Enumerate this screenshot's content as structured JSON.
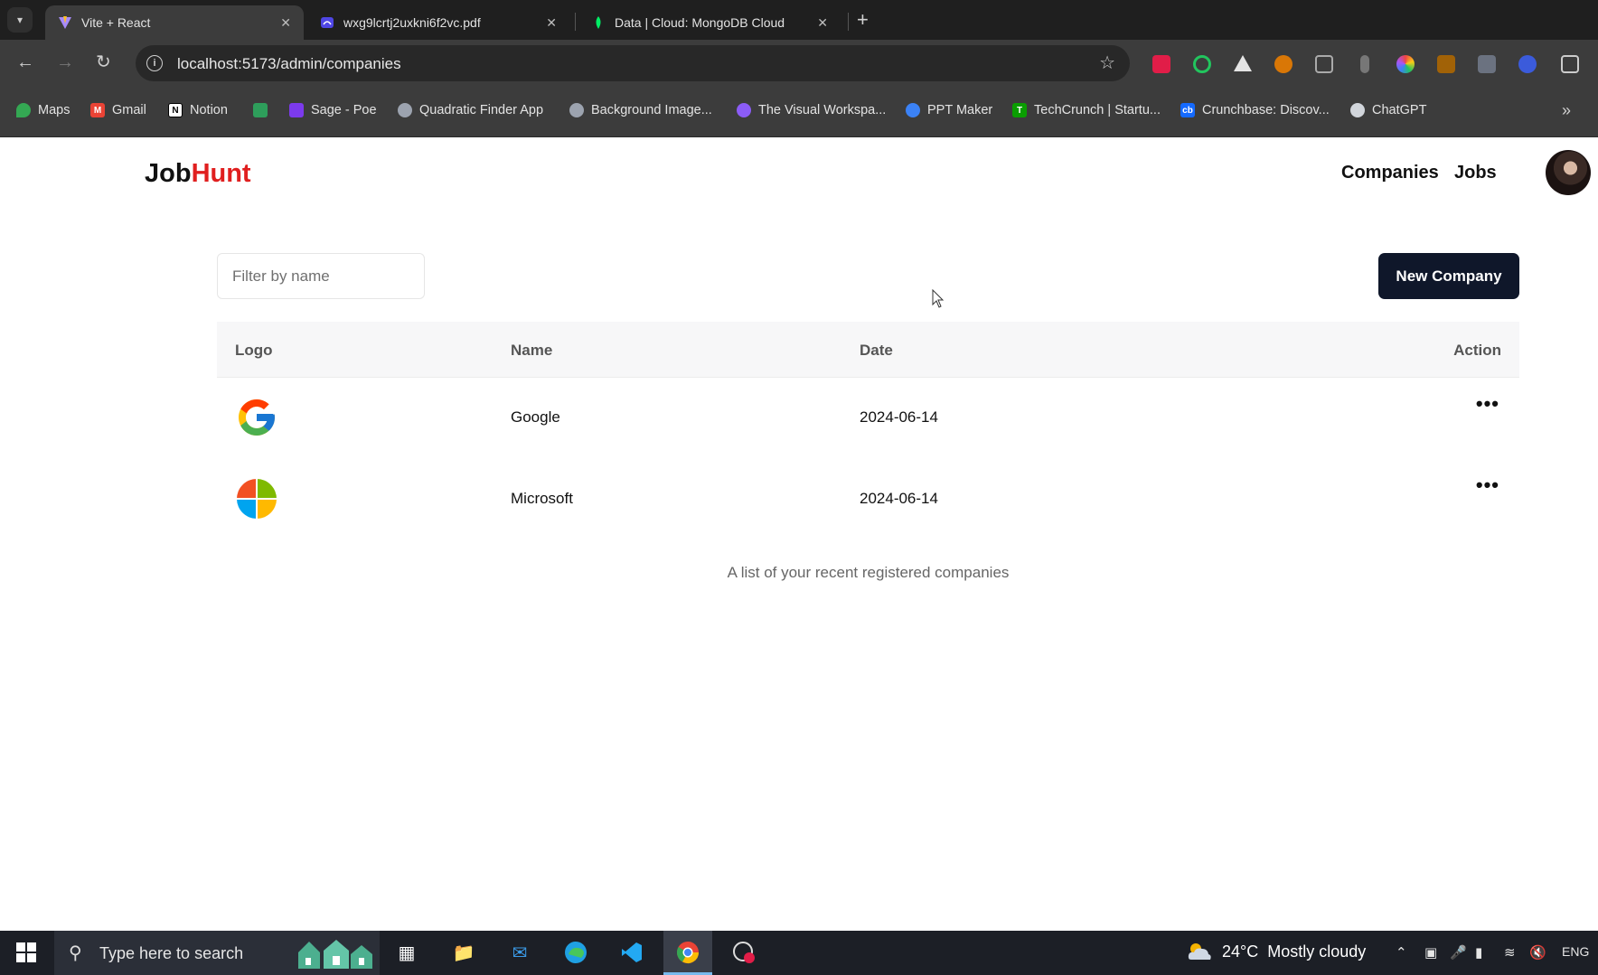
{
  "browser": {
    "tabs": [
      {
        "title": "Vite + React",
        "active": true
      },
      {
        "title": "wxg9lcrtj2uxkni6f2vc.pdf",
        "active": false
      },
      {
        "title": "Data | Cloud: MongoDB Cloud",
        "active": false
      }
    ],
    "url": "localhost:5173/admin/companies",
    "bookmarks": [
      {
        "label": "Maps",
        "color": "#34a853"
      },
      {
        "label": "Gmail",
        "color": "#ea4335"
      },
      {
        "label": "Notion",
        "color": "#ffffff"
      },
      {
        "label": "",
        "color": "#2e9e5b"
      },
      {
        "label": "Sage - Poe",
        "color": "#7c3aed"
      },
      {
        "label": "Quadratic Finder App",
        "color": "#9ca3af"
      },
      {
        "label": "Background Image...",
        "color": "#9ca3af"
      },
      {
        "label": "The Visual Workspa...",
        "color": "#8b5cf6"
      },
      {
        "label": "PPT Maker",
        "color": "#3b82f6"
      },
      {
        "label": "TechCrunch | Startu...",
        "color": "#0a9e01"
      },
      {
        "label": "Crunchbase: Discov...",
        "color": "#146aff"
      },
      {
        "label": "ChatGPT",
        "color": "#d1d5db"
      }
    ]
  },
  "app": {
    "brand": {
      "part1": "Job",
      "part2": "Hunt"
    },
    "nav": {
      "companies": "Companies",
      "jobs": "Jobs"
    },
    "filter": {
      "placeholder": "Filter by name",
      "value": ""
    },
    "new_company_label": "New Company",
    "table": {
      "headers": {
        "logo": "Logo",
        "name": "Name",
        "date": "Date",
        "action": "Action"
      },
      "rows": [
        {
          "logo": "google-logo",
          "name": "Google",
          "date": "2024-06-14",
          "action": "•••"
        },
        {
          "logo": "microsoft-logo",
          "name": "Microsoft",
          "date": "2024-06-14",
          "action": "•••"
        }
      ],
      "caption": "A list of your recent registered companies"
    }
  },
  "taskbar": {
    "search_placeholder": "Type here to search",
    "weather": {
      "temp": "24°C",
      "condition": "Mostly cloudy"
    },
    "language": "ENG"
  },
  "colors": {
    "brand_accent": "#e01f1f",
    "primary_button": "#0f172a"
  }
}
